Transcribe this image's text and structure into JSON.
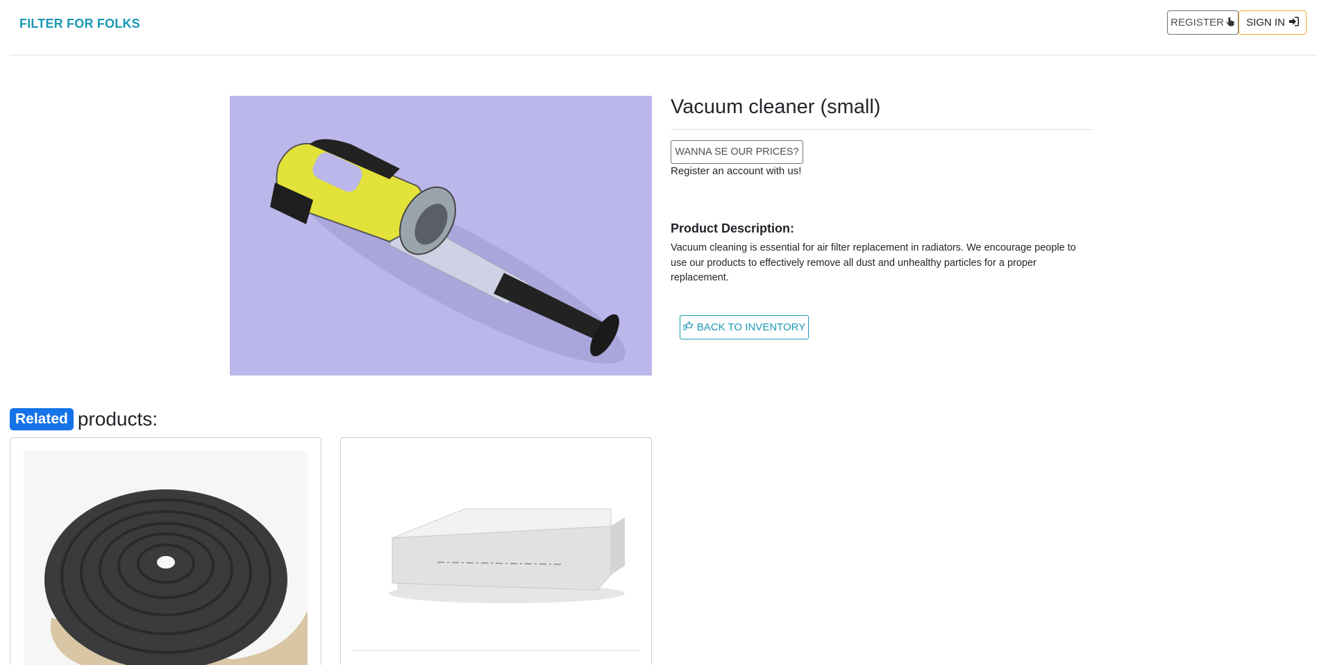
{
  "navbar": {
    "brand": "FILTER FOR FOLKS",
    "register_label": "REGISTER",
    "signin_label": "SIGN IN",
    "register_icon": "hand-pointer-icon",
    "signin_icon": "sign-in-icon"
  },
  "product": {
    "title": "Vacuum cleaner (small)",
    "prices_button": "WANNA SE OUR PRICES?",
    "register_note": "Register an account with us!",
    "description_heading": "Product Description:",
    "description": "Vacuum cleaning is essential for air filter replacement in radiators. We encourage people to use our products to effectively remove all dust and unhealthy particles for a proper replacement.",
    "back_button": "BACK TO INVENTORY",
    "back_icon": "hand-point-right-icon",
    "image_background": "#bcb7ea"
  },
  "related": {
    "badge": "Related",
    "heading": "products:"
  },
  "colors": {
    "brand": "#1a98b4",
    "badge": "#1573e8",
    "signin_border": "#f0ad2a"
  }
}
